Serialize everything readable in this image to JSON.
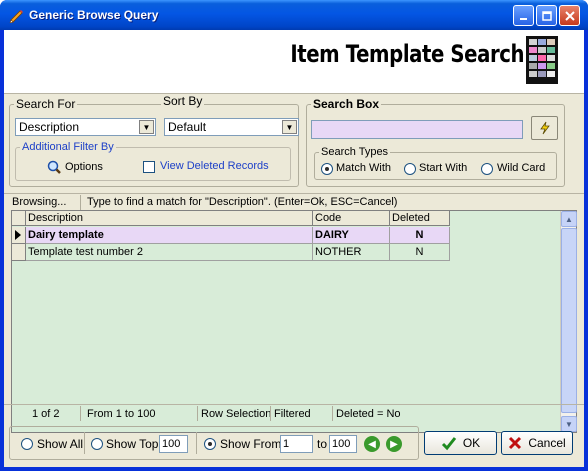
{
  "window": {
    "title": "Generic Browse Query"
  },
  "banner": {
    "title": "Item Template Search"
  },
  "search_for": {
    "legend": "Search For",
    "value": "Description"
  },
  "sort_by": {
    "legend": "Sort By",
    "value": "Default"
  },
  "additional_filter": {
    "legend": "Additional Filter By",
    "options_label": "Options",
    "view_deleted_label": "View Deleted Records"
  },
  "search_box": {
    "legend": "Search Box",
    "value": ""
  },
  "search_types": {
    "legend": "Search Types",
    "options": [
      "Match With",
      "Start With",
      "Wild Card"
    ],
    "selected": "Match With"
  },
  "status_top": {
    "browsing": "Browsing...",
    "hint": "Type to find a match for \"Description\". (Enter=Ok, ESC=Cancel)"
  },
  "grid": {
    "columns": [
      "Description",
      "Code",
      "Deleted"
    ],
    "rows": [
      {
        "description": "Dairy template",
        "code": "DAIRY",
        "deleted": "N"
      },
      {
        "description": "Template test number 2",
        "code": "NOTHER",
        "deleted": "N"
      }
    ]
  },
  "status_bottom": {
    "position": "1 of 2",
    "range": "From 1 to 100",
    "selection": "Row Selection",
    "filtered": "Filtered",
    "deleted": "Deleted = No"
  },
  "footer": {
    "show_all": "Show All",
    "show_top": "Show Top",
    "show_top_value": "100",
    "show_from": "Show From",
    "from_value": "1",
    "to_label": "to",
    "to_value": "100",
    "ok": "OK",
    "cancel": "Cancel"
  },
  "colors": {
    "selected_row": "#e8d8f6",
    "grid_bg": "#d8ecd8",
    "titlebar": "#0456e4"
  }
}
